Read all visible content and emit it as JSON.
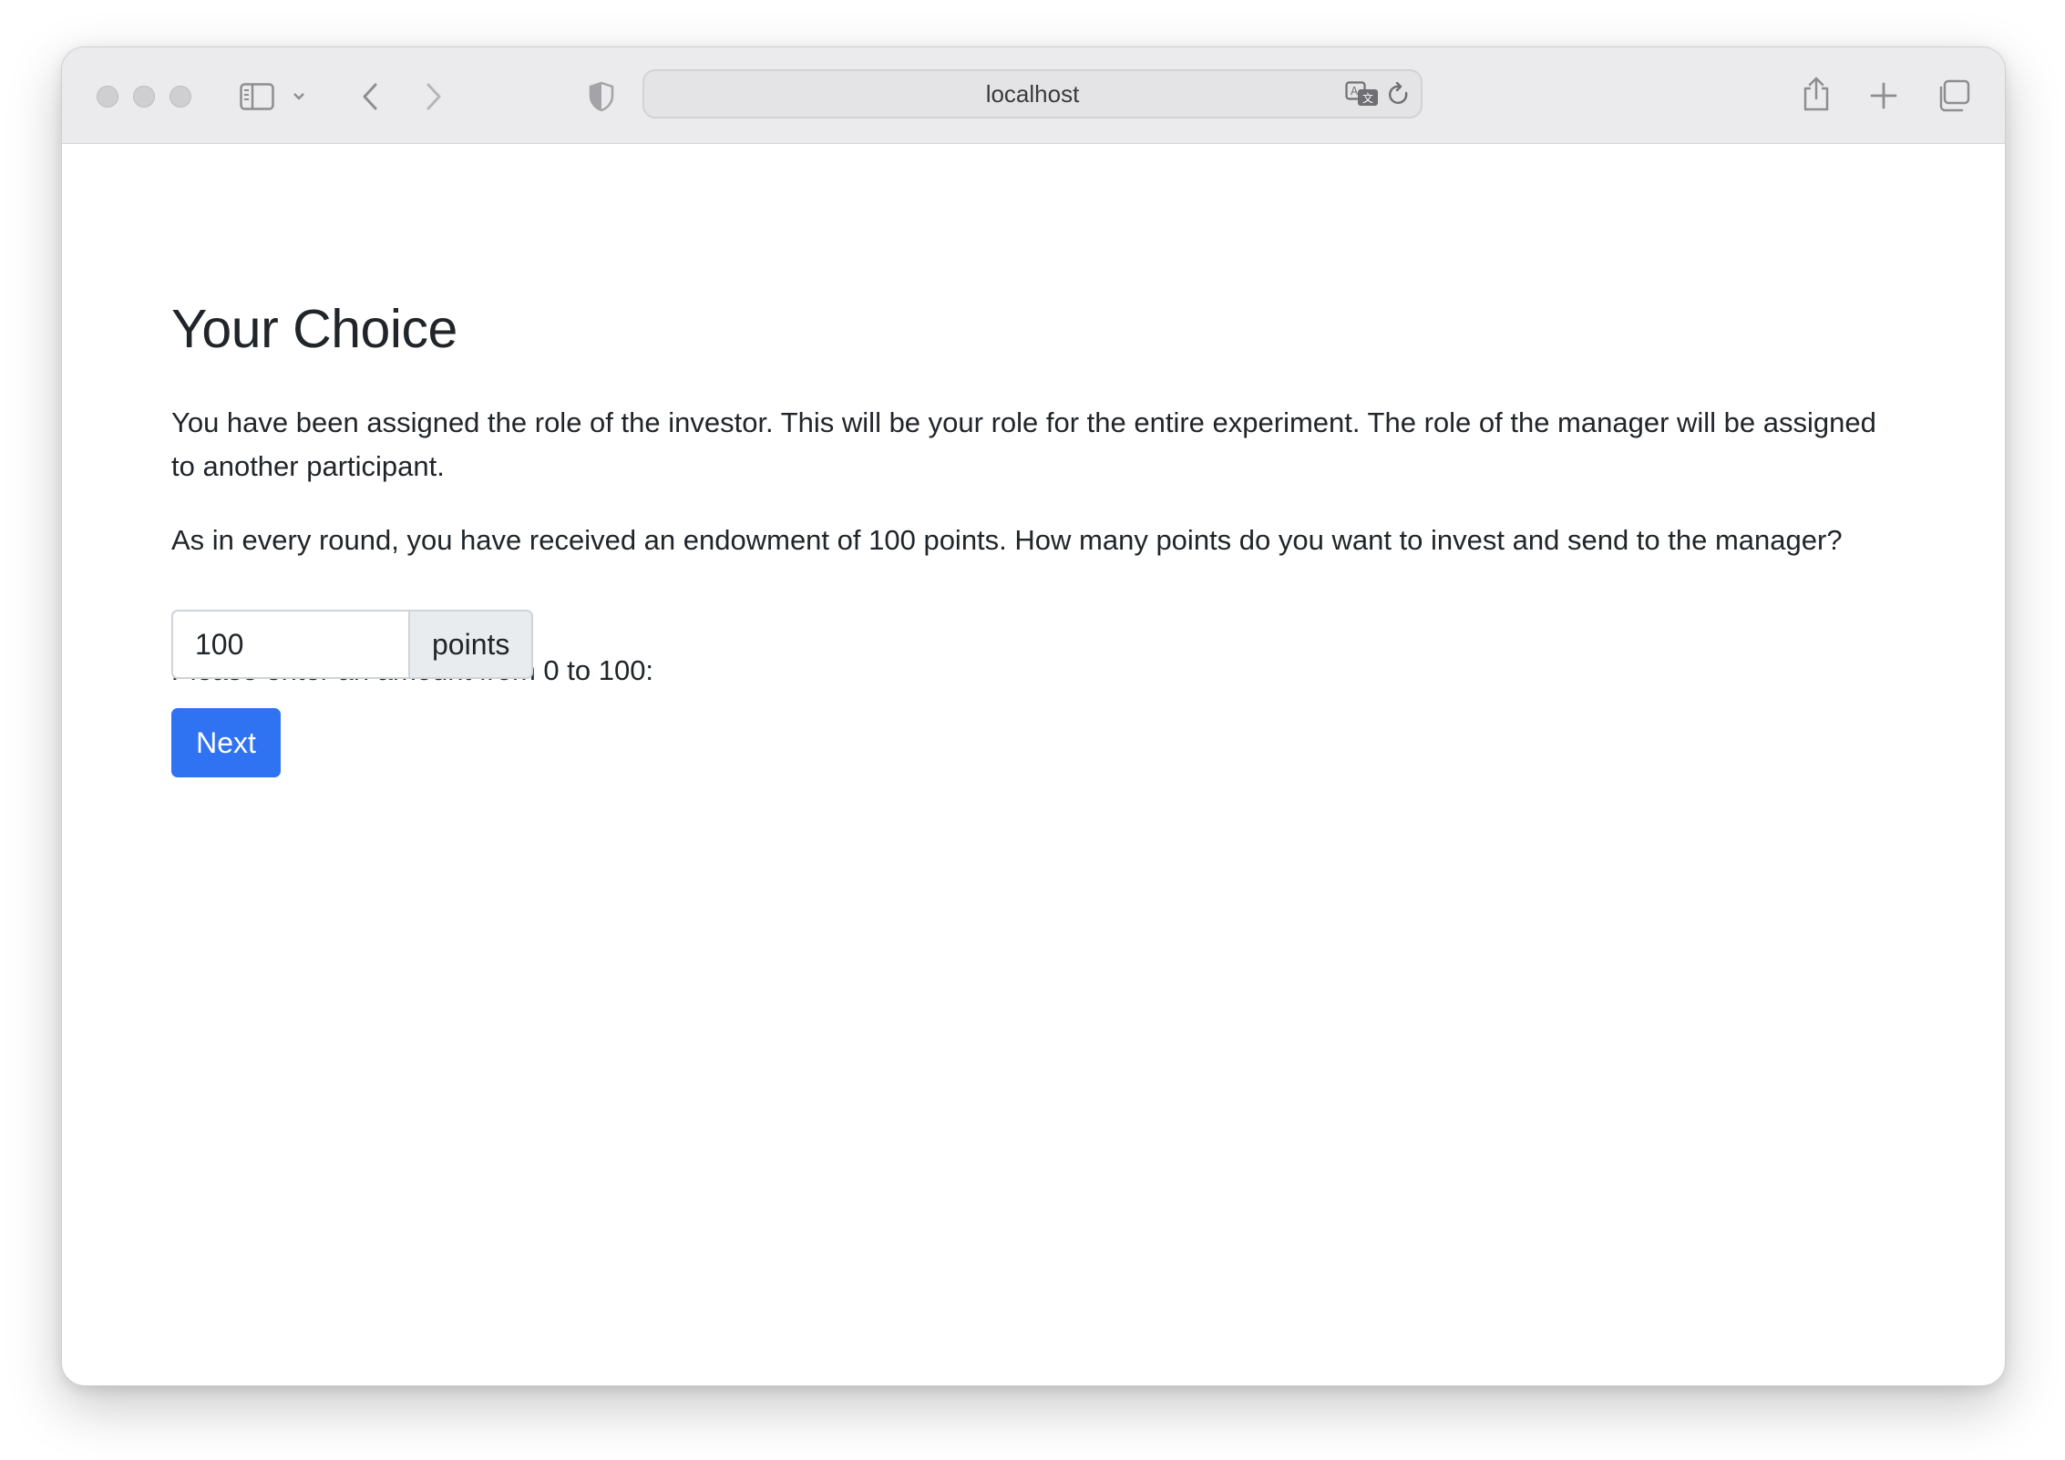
{
  "browser": {
    "address": "localhost",
    "icons": {
      "sidebar": "sidebar-icon",
      "chevron": "chevron-down-icon",
      "back": "back-arrow-icon",
      "forward": "forward-arrow-icon",
      "privacy": "shield-icon",
      "translate": "translate-icon",
      "reload": "reload-icon",
      "share": "share-icon",
      "new_tab": "plus-icon",
      "tabs": "tab-overview-icon"
    }
  },
  "page": {
    "title": "Your Choice",
    "paragraph1": "You have been assigned the role of the investor. This will be your role for the entire experiment. The role of the manager will be assigned to another participant.",
    "paragraph2": "As in every round, you have received an endowment of 100 points. How many points do you want to invest and send to the manager?",
    "prompt": "Please enter an amount from 0 to 100:",
    "amount_value": "100",
    "unit": "points",
    "next_label": "Next"
  },
  "colors": {
    "primary": "#2f72f2",
    "text": "#212529",
    "addon_bg": "#e9ecef"
  }
}
